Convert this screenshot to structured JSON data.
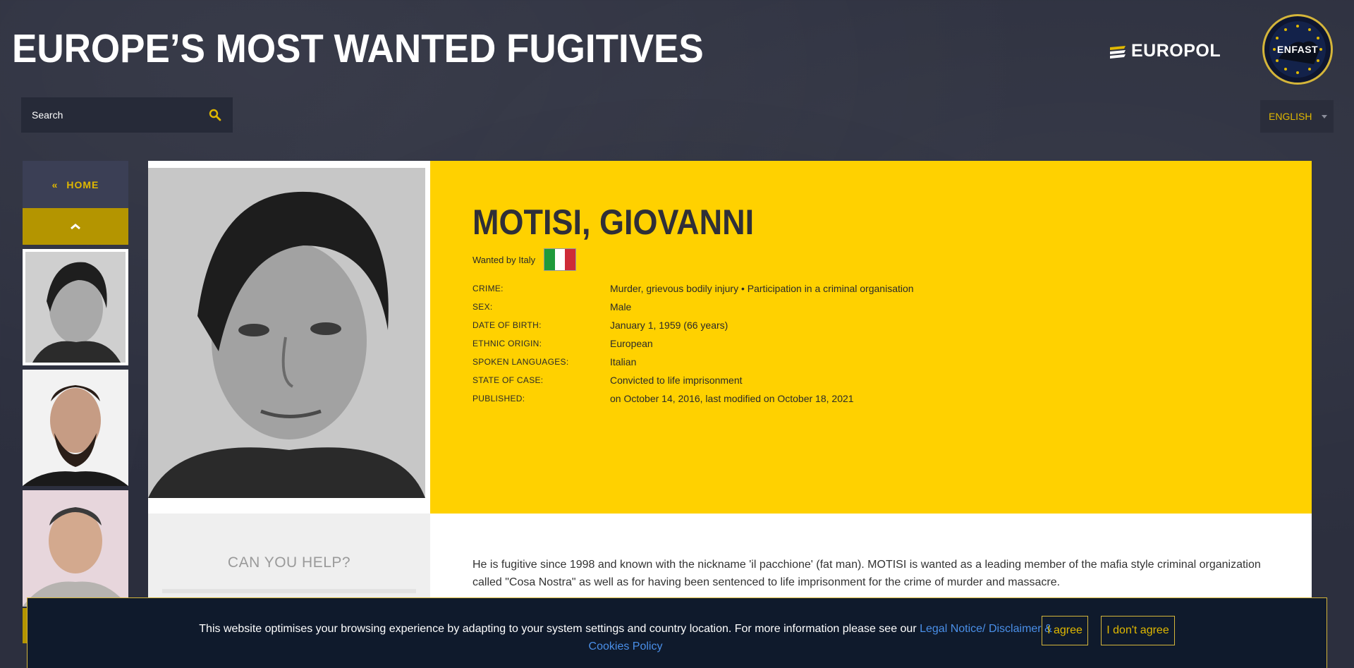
{
  "header": {
    "title": "EUROPE’S MOST WANTED FUGITIVES",
    "europol_logo_text": "EUROPOL",
    "enfast_badge_text": "ENFAST"
  },
  "search": {
    "placeholder": "Search"
  },
  "language": {
    "selected": "ENGLISH"
  },
  "sidebar": {
    "home_label": "HOME",
    "home_arrow": "«",
    "up_arrow": "︿"
  },
  "person": {
    "name": "MOTISI, GIOVANNI",
    "wanted_by": "Wanted by Italy",
    "details": [
      {
        "label": "CRIME:",
        "value": "Murder, grievous bodily injury • Participation in a criminal organisation"
      },
      {
        "label": "SEX:",
        "value": "Male"
      },
      {
        "label": "DATE OF BIRTH:",
        "value": "January 1, 1959 (66 years)"
      },
      {
        "label": "ETHNIC ORIGIN:",
        "value": "European"
      },
      {
        "label": "SPOKEN LANGUAGES:",
        "value": "Italian"
      },
      {
        "label": "STATE OF CASE:",
        "value": "Convicted to life imprisonment"
      },
      {
        "label": "PUBLISHED:",
        "value": "on October 14, 2016, last modified on October 18, 2021"
      }
    ],
    "description": "He is fugitive since 1998 and known with the nickname  'il pacchione' (fat man). MOTISI is wanted as a leading member of the mafia style criminal organization called \"Cosa Nostra\" as well as for having been sentenced to life imprisonment for the crime of murder and massacre."
  },
  "help": {
    "title": "CAN YOU HELP?"
  },
  "cookie": {
    "text": "This website optimises your browsing experience by adapting to your system settings and country location. For more information please see our ",
    "link_text": "Legal Notice/ Disclaimer & Cookies Policy",
    "agree_label": "I agree",
    "disagree_label": "I don't agree"
  },
  "colors": {
    "accent_yellow": "#ffd100",
    "gold": "#e0b800",
    "flag_green": "#1e9a3a",
    "flag_white": "#ffffff",
    "flag_red": "#ce2b37"
  }
}
